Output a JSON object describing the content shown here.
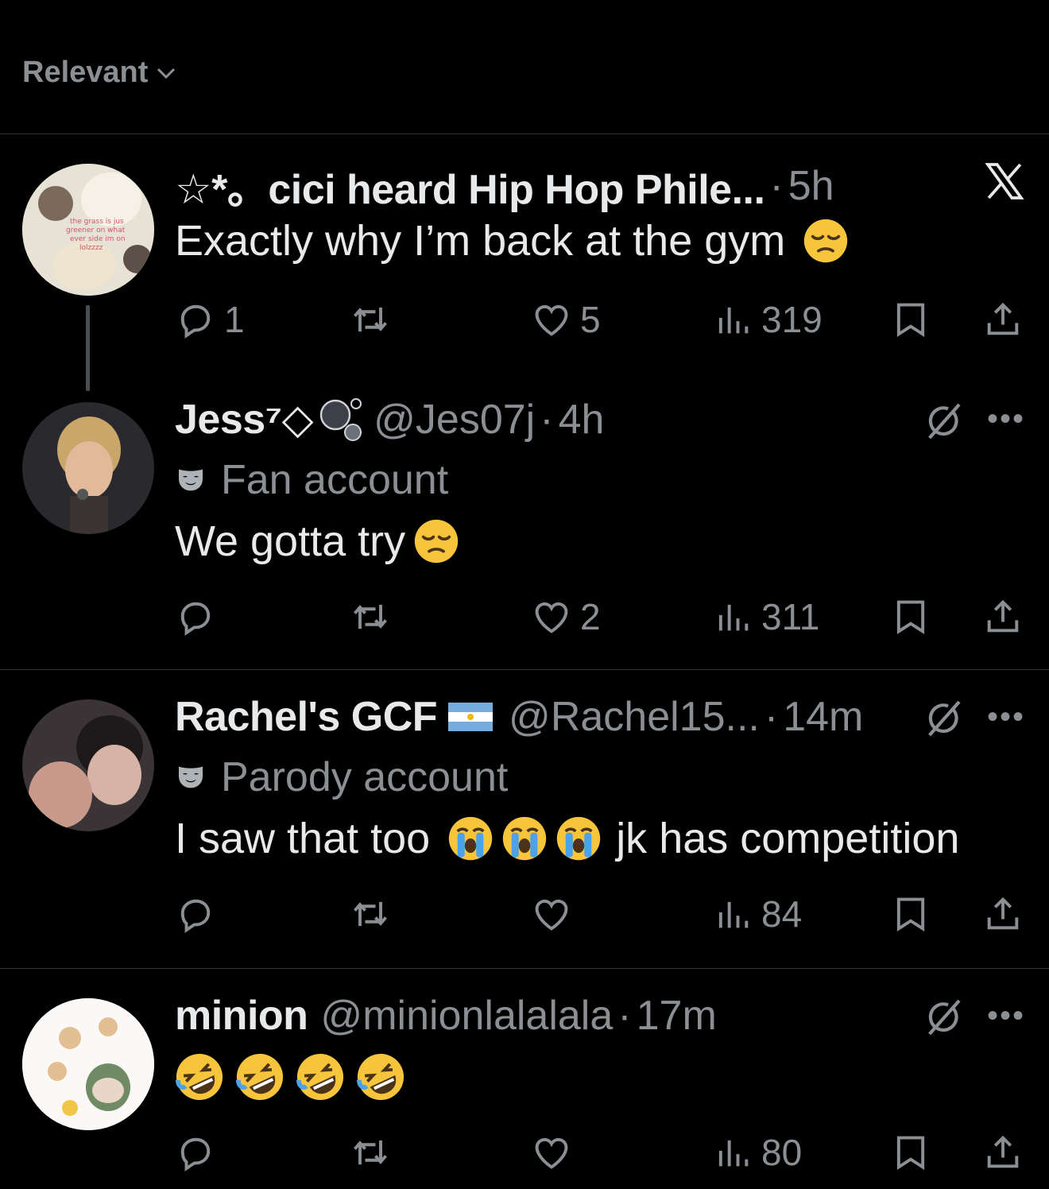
{
  "sort": {
    "label": "Relevant"
  },
  "posts": [
    {
      "name": "☆*。cici heard Hip Hop Phile...",
      "time": "5h",
      "text": "Exactly why I’m back at the gym",
      "emoji": [
        "pensive"
      ],
      "replies": "1",
      "likes": "5",
      "views": "319",
      "avatar_text": "the grass is jus greener on what ever side im on lolzzzz"
    },
    {
      "name": "Jess⁷◇",
      "handle": "@Jes07j",
      "time": "4h",
      "badge": "Fan account",
      "text": "We gotta try",
      "emoji": [
        "pensive"
      ],
      "replies": "",
      "likes": "2",
      "views": "311"
    },
    {
      "name": "Rachel's GCF",
      "handle": "@Rachel15...",
      "time": "14m",
      "badge": "Parody account",
      "text_before": "I saw that too",
      "text_after": "jk has competition",
      "emoji": [
        "sob",
        "sob",
        "sob"
      ],
      "replies": "",
      "likes": "",
      "views": "84"
    },
    {
      "name": "minion",
      "handle": "@minionlalalala",
      "time": "17m",
      "emoji": [
        "rofl",
        "rofl",
        "rofl",
        "rofl"
      ],
      "replies": "",
      "likes": "",
      "views": "80"
    }
  ],
  "colors": {
    "background": "#000000",
    "text": "#e7e9ea",
    "muted": "#8b8f94",
    "divider": "#2f3336",
    "emoji": "#f7c53b"
  },
  "icons": [
    "chevron-down-icon",
    "x-logo-icon",
    "reply-icon",
    "retweet-icon",
    "heart-icon",
    "views-icon",
    "bookmark-icon",
    "share-icon",
    "grok-icon",
    "more-icon",
    "mask-icon",
    "flag-icon",
    "bubbles-icon"
  ]
}
